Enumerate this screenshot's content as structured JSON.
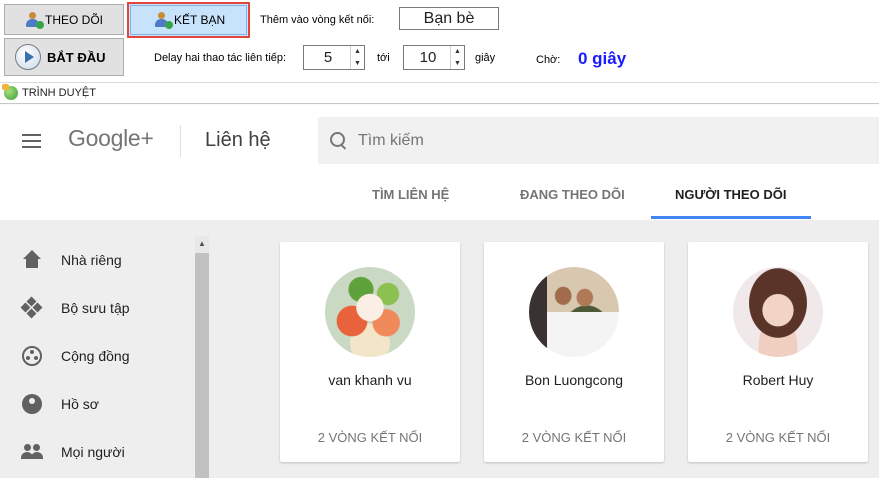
{
  "toolbar": {
    "follow_label": "THEO DÕI",
    "friend_label": "KẾT BẠN",
    "start_label": "BẮT ĐẦU",
    "add_circle_label": "Thêm vào vòng kết nối:",
    "circle_value": "Bạn bè",
    "delay_label": "Delay hai thao tác liên tiếp:",
    "delay_from": "5",
    "to_label": "tới",
    "delay_to": "10",
    "seconds_label": "giây",
    "wait_label": "Chờ:",
    "wait_value": "0 giây"
  },
  "browser_tab": {
    "label": "TRÌNH DUYỆT",
    "icon": "globe-icon"
  },
  "header": {
    "logo": "Google+",
    "section_title": "Liên hệ",
    "search_placeholder": "Tìm kiếm",
    "tabs": [
      {
        "label": "TÌM LIÊN HỆ",
        "active": false
      },
      {
        "label": "ĐANG THEO DÕI",
        "active": false
      },
      {
        "label": "NGƯỜI THEO DÕI",
        "active": true
      }
    ],
    "active_tab_color": "#4285f4"
  },
  "sidebar": {
    "items": [
      {
        "label": "Nhà riêng",
        "icon": "home-icon"
      },
      {
        "label": "Bộ sưu tập",
        "icon": "collections-icon"
      },
      {
        "label": "Cộng đồng",
        "icon": "communities-icon"
      },
      {
        "label": "Hồ sơ",
        "icon": "profile-icon"
      },
      {
        "label": "Mọi người",
        "icon": "people-icon"
      }
    ]
  },
  "people": [
    {
      "name": "van khanh vu",
      "circles": "2 VÒNG KẾT NỐI"
    },
    {
      "name": "Bon Luongcong",
      "circles": "2 VÒNG KẾT NỐI"
    },
    {
      "name": "Robert Huy",
      "circles": "2 VÒNG KẾT NỐI"
    }
  ],
  "colors": {
    "highlight_border": "#e0463a",
    "wait_value": "#1a1aff",
    "content_bg": "#eeeeee"
  }
}
